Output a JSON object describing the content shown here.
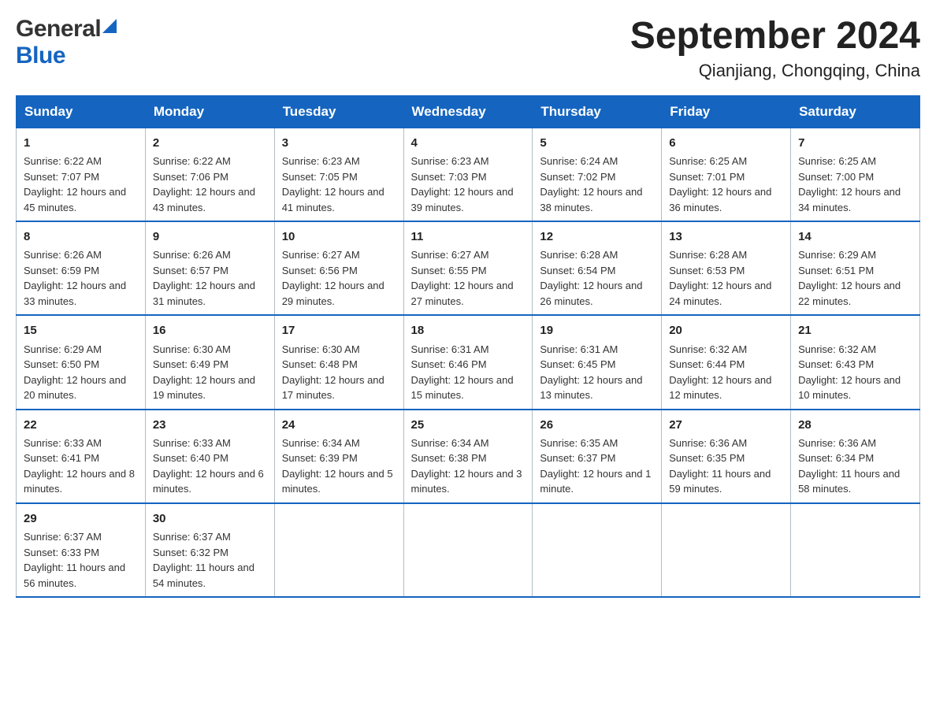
{
  "logo": {
    "general": "General",
    "blue": "Blue"
  },
  "title": "September 2024",
  "subtitle": "Qianjiang, Chongqing, China",
  "days_of_week": [
    "Sunday",
    "Monday",
    "Tuesday",
    "Wednesday",
    "Thursday",
    "Friday",
    "Saturday"
  ],
  "weeks": [
    [
      {
        "day": "1",
        "sunrise": "6:22 AM",
        "sunset": "7:07 PM",
        "daylight": "12 hours and 45 minutes."
      },
      {
        "day": "2",
        "sunrise": "6:22 AM",
        "sunset": "7:06 PM",
        "daylight": "12 hours and 43 minutes."
      },
      {
        "day": "3",
        "sunrise": "6:23 AM",
        "sunset": "7:05 PM",
        "daylight": "12 hours and 41 minutes."
      },
      {
        "day": "4",
        "sunrise": "6:23 AM",
        "sunset": "7:03 PM",
        "daylight": "12 hours and 39 minutes."
      },
      {
        "day": "5",
        "sunrise": "6:24 AM",
        "sunset": "7:02 PM",
        "daylight": "12 hours and 38 minutes."
      },
      {
        "day": "6",
        "sunrise": "6:25 AM",
        "sunset": "7:01 PM",
        "daylight": "12 hours and 36 minutes."
      },
      {
        "day": "7",
        "sunrise": "6:25 AM",
        "sunset": "7:00 PM",
        "daylight": "12 hours and 34 minutes."
      }
    ],
    [
      {
        "day": "8",
        "sunrise": "6:26 AM",
        "sunset": "6:59 PM",
        "daylight": "12 hours and 33 minutes."
      },
      {
        "day": "9",
        "sunrise": "6:26 AM",
        "sunset": "6:57 PM",
        "daylight": "12 hours and 31 minutes."
      },
      {
        "day": "10",
        "sunrise": "6:27 AM",
        "sunset": "6:56 PM",
        "daylight": "12 hours and 29 minutes."
      },
      {
        "day": "11",
        "sunrise": "6:27 AM",
        "sunset": "6:55 PM",
        "daylight": "12 hours and 27 minutes."
      },
      {
        "day": "12",
        "sunrise": "6:28 AM",
        "sunset": "6:54 PM",
        "daylight": "12 hours and 26 minutes."
      },
      {
        "day": "13",
        "sunrise": "6:28 AM",
        "sunset": "6:53 PM",
        "daylight": "12 hours and 24 minutes."
      },
      {
        "day": "14",
        "sunrise": "6:29 AM",
        "sunset": "6:51 PM",
        "daylight": "12 hours and 22 minutes."
      }
    ],
    [
      {
        "day": "15",
        "sunrise": "6:29 AM",
        "sunset": "6:50 PM",
        "daylight": "12 hours and 20 minutes."
      },
      {
        "day": "16",
        "sunrise": "6:30 AM",
        "sunset": "6:49 PM",
        "daylight": "12 hours and 19 minutes."
      },
      {
        "day": "17",
        "sunrise": "6:30 AM",
        "sunset": "6:48 PM",
        "daylight": "12 hours and 17 minutes."
      },
      {
        "day": "18",
        "sunrise": "6:31 AM",
        "sunset": "6:46 PM",
        "daylight": "12 hours and 15 minutes."
      },
      {
        "day": "19",
        "sunrise": "6:31 AM",
        "sunset": "6:45 PM",
        "daylight": "12 hours and 13 minutes."
      },
      {
        "day": "20",
        "sunrise": "6:32 AM",
        "sunset": "6:44 PM",
        "daylight": "12 hours and 12 minutes."
      },
      {
        "day": "21",
        "sunrise": "6:32 AM",
        "sunset": "6:43 PM",
        "daylight": "12 hours and 10 minutes."
      }
    ],
    [
      {
        "day": "22",
        "sunrise": "6:33 AM",
        "sunset": "6:41 PM",
        "daylight": "12 hours and 8 minutes."
      },
      {
        "day": "23",
        "sunrise": "6:33 AM",
        "sunset": "6:40 PM",
        "daylight": "12 hours and 6 minutes."
      },
      {
        "day": "24",
        "sunrise": "6:34 AM",
        "sunset": "6:39 PM",
        "daylight": "12 hours and 5 minutes."
      },
      {
        "day": "25",
        "sunrise": "6:34 AM",
        "sunset": "6:38 PM",
        "daylight": "12 hours and 3 minutes."
      },
      {
        "day": "26",
        "sunrise": "6:35 AM",
        "sunset": "6:37 PM",
        "daylight": "12 hours and 1 minute."
      },
      {
        "day": "27",
        "sunrise": "6:36 AM",
        "sunset": "6:35 PM",
        "daylight": "11 hours and 59 minutes."
      },
      {
        "day": "28",
        "sunrise": "6:36 AM",
        "sunset": "6:34 PM",
        "daylight": "11 hours and 58 minutes."
      }
    ],
    [
      {
        "day": "29",
        "sunrise": "6:37 AM",
        "sunset": "6:33 PM",
        "daylight": "11 hours and 56 minutes."
      },
      {
        "day": "30",
        "sunrise": "6:37 AM",
        "sunset": "6:32 PM",
        "daylight": "11 hours and 54 minutes."
      },
      null,
      null,
      null,
      null,
      null
    ]
  ]
}
